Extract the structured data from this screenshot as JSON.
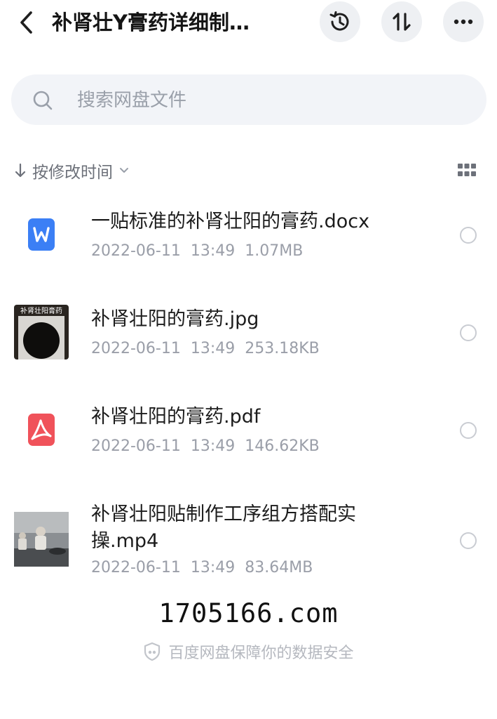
{
  "header": {
    "title": "补肾壮Y膏药详细制…",
    "icons": [
      "chevron-left-icon",
      "history-icon",
      "sort-icon",
      "more-icon"
    ]
  },
  "search": {
    "placeholder": "搜索网盘文件"
  },
  "sort": {
    "label": "按修改时间"
  },
  "files": [
    {
      "name": "一贴标准的补肾壮阳的膏药.docx",
      "date": "2022-06-11",
      "time": "13:49",
      "size": "1.07MB",
      "type": "word"
    },
    {
      "name": "补肾壮阳的膏药.jpg",
      "date": "2022-06-11",
      "time": "13:49",
      "size": "253.18KB",
      "type": "image",
      "thumb_text": "补肾壮阳膏药"
    },
    {
      "name": "补肾壮阳的膏药.pdf",
      "date": "2022-06-11",
      "time": "13:49",
      "size": "146.62KB",
      "type": "pdf"
    },
    {
      "name": "补肾壮阳贴制作工序组方搭配实操.mp4",
      "date": "2022-06-11",
      "time": "13:49",
      "size": "83.64MB",
      "type": "video"
    }
  ],
  "watermark": "1705166.com",
  "footer": {
    "text": "百度网盘保障你的数据安全"
  },
  "colors": {
    "word": "#3b7ff5",
    "pdf": "#f0525a",
    "meta": "#9a9ea8"
  }
}
